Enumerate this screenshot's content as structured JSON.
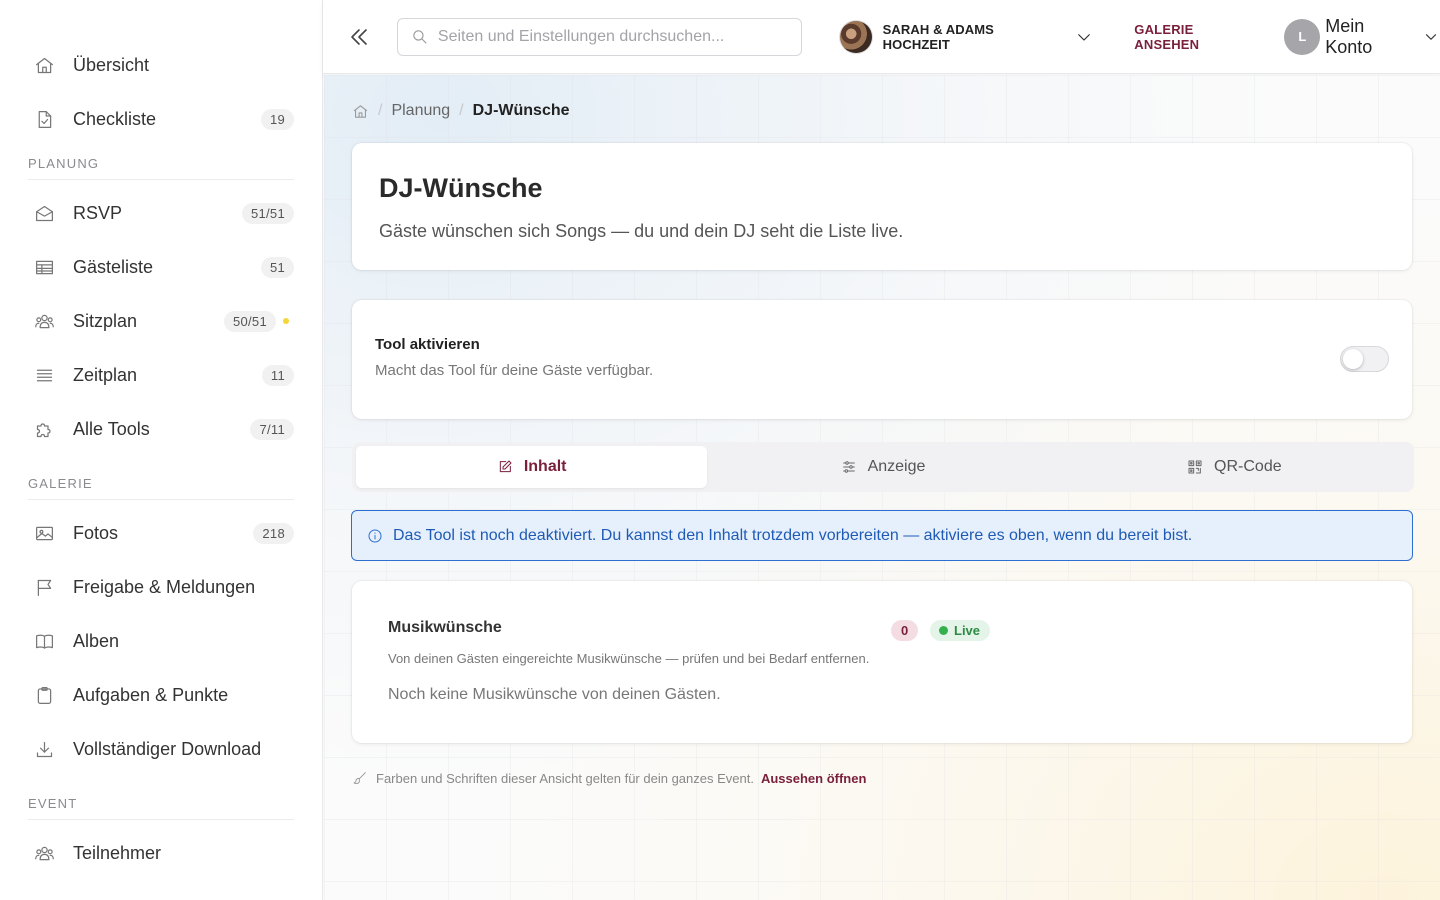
{
  "sidebar": {
    "top_items": [
      {
        "label": "Übersicht",
        "icon": "home-icon"
      },
      {
        "label": "Checkliste",
        "icon": "checklist-icon",
        "badge": "19"
      }
    ],
    "sections": [
      {
        "label": "PLANUNG",
        "items": [
          {
            "label": "RSVP",
            "icon": "envelope-icon",
            "badge": "51/51"
          },
          {
            "label": "Gästeliste",
            "icon": "table-icon",
            "badge": "51"
          },
          {
            "label": "Sitzplan",
            "icon": "people-icon",
            "badge": "50/51",
            "dot_color": "#f4d53a"
          },
          {
            "label": "Zeitplan",
            "icon": "lines-icon",
            "badge": "11"
          },
          {
            "label": "Alle Tools",
            "icon": "puzzle-icon",
            "badge": "7/11"
          }
        ]
      },
      {
        "label": "GALERIE",
        "items": [
          {
            "label": "Fotos",
            "icon": "image-icon",
            "badge": "218"
          },
          {
            "label": "Freigabe & Meldungen",
            "icon": "flag-icon"
          },
          {
            "label": "Alben",
            "icon": "book-icon"
          },
          {
            "label": "Aufgaben & Punkte",
            "icon": "clipboard-icon"
          },
          {
            "label": "Vollständiger Download",
            "icon": "download-icon"
          }
        ]
      },
      {
        "label": "EVENT",
        "items": [
          {
            "label": "Teilnehmer",
            "icon": "people-icon"
          }
        ]
      }
    ]
  },
  "header": {
    "search_placeholder": "Seiten und Einstellungen durchsuchen...",
    "event_name": "SARAH & ADAMS HOCHZEIT",
    "gallery_link": "GALERIE ANSEHEN",
    "account_initial": "L",
    "account_label": "Mein Konto"
  },
  "breadcrumb": {
    "parent": "Planung",
    "current": "DJ-Wünsche"
  },
  "page": {
    "title": "DJ-Wünsche",
    "subtitle": "Gäste wünschen sich Songs — du und dein DJ seht die Liste live."
  },
  "tool_toggle": {
    "title": "Tool aktivieren",
    "description": "Macht das Tool für deine Gäste verfügbar.",
    "enabled": false
  },
  "tabs": [
    {
      "label": "Inhalt",
      "icon": "edit-icon",
      "active": true
    },
    {
      "label": "Anzeige",
      "icon": "sliders-icon",
      "active": false
    },
    {
      "label": "QR-Code",
      "icon": "qr-icon",
      "active": false
    }
  ],
  "alert": {
    "text": "Das Tool ist noch deaktiviert. Du kannst den Inhalt trotzdem vorbereiten — aktiviere es oben, wenn du bereit bist."
  },
  "music": {
    "title": "Musikwünsche",
    "count": "0",
    "status": "Live",
    "description": "Von deinen Gästen eingereichte Musikwünsche — prüfen und bei Bedarf entfernen.",
    "empty": "Noch keine Musikwünsche von deinen Gästen."
  },
  "footnote": {
    "text": "Farben und Schriften dieser Ansicht gelten für dein ganzes Event.",
    "link": "Aussehen öffnen"
  },
  "colors": {
    "accent": "#7a1f3c",
    "info": "#2d6fd0",
    "live": "#34b04f",
    "warning_dot": "#f4d53a"
  }
}
